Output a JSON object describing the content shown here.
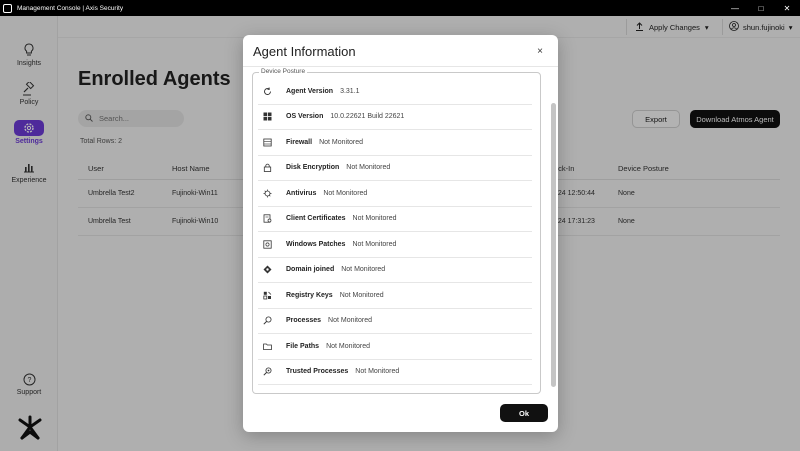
{
  "window": {
    "title": "Management Console | Axis Security"
  },
  "sidebar": {
    "items": [
      {
        "label": "Insights",
        "icon": "lightbulb-icon"
      },
      {
        "label": "Policy",
        "icon": "gavel-icon"
      },
      {
        "label": "Settings",
        "icon": "gear-icon",
        "active": true
      },
      {
        "label": "Experience",
        "icon": "bar-chart-icon"
      }
    ],
    "support": {
      "label": "Support",
      "icon": "question-icon"
    }
  },
  "header": {
    "apply_changes": "Apply Changes",
    "user": "shun.fujinoki"
  },
  "main": {
    "title": "Enrolled Agents",
    "search_placeholder": "Search...",
    "total_rows": "Total Rows: 2",
    "export": "Export",
    "download": "Download Atmos Agent",
    "columns": [
      "User",
      "Host Name",
      "eck-In",
      "Device Posture"
    ],
    "rows": [
      {
        "user": "Umbrella Test2",
        "host": "Fujinoki-Win11",
        "checkin": "024 12:50:44",
        "posture": "None"
      },
      {
        "user": "Umbrella Test",
        "host": "Fujinoki-Win10",
        "checkin": "024 17:31:23",
        "posture": "None"
      }
    ]
  },
  "modal": {
    "title": "Agent Information",
    "close": "×",
    "section_label": "Device Posture",
    "ok": "Ok",
    "rows": [
      {
        "label": "Agent Version",
        "value": "3.31.1",
        "icon": "refresh-icon"
      },
      {
        "label": "OS Version",
        "value": "10.0.22621 Build 22621",
        "icon": "windows-icon"
      },
      {
        "label": "Firewall",
        "value": "Not Monitored",
        "icon": "firewall-icon"
      },
      {
        "label": "Disk Encryption",
        "value": "Not Monitored",
        "icon": "lock-icon"
      },
      {
        "label": "Antivirus",
        "value": "Not Monitored",
        "icon": "antivirus-icon"
      },
      {
        "label": "Client Certificates",
        "value": "Not Monitored",
        "icon": "certificate-icon"
      },
      {
        "label": "Windows Patches",
        "value": "Not Monitored",
        "icon": "patch-icon"
      },
      {
        "label": "Domain joined",
        "value": "Not Monitored",
        "icon": "domain-icon"
      },
      {
        "label": "Registry Keys",
        "value": "Not Monitored",
        "icon": "registry-icon"
      },
      {
        "label": "Processes",
        "value": "Not Monitored",
        "icon": "process-icon"
      },
      {
        "label": "File Paths",
        "value": "Not Monitored",
        "icon": "folder-icon"
      },
      {
        "label": "Trusted Processes",
        "value": "Not Monitored",
        "icon": "trusted-process-icon"
      }
    ]
  }
}
